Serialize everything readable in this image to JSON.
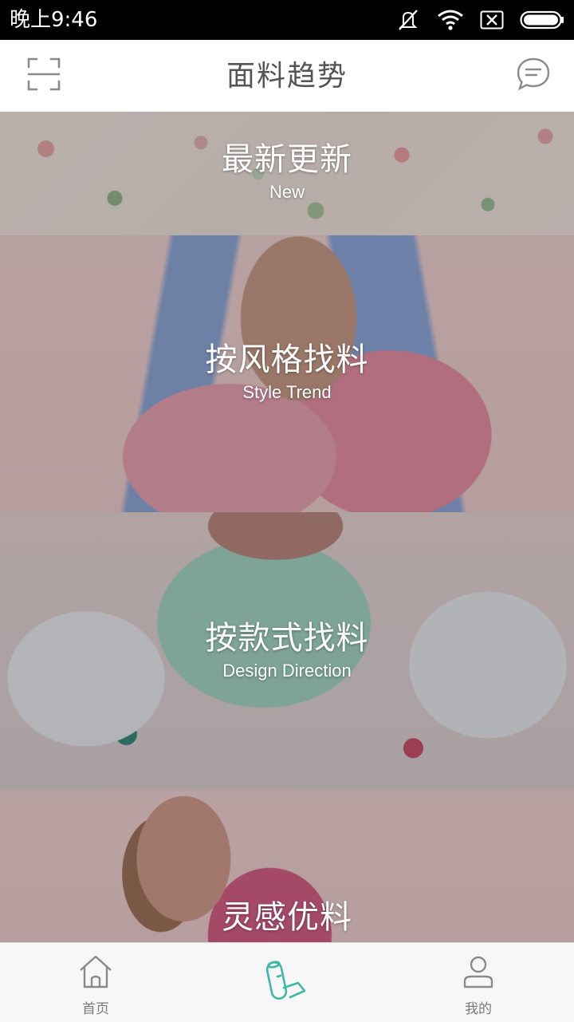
{
  "status_bar": {
    "time": "晚上9:46",
    "icons": [
      "mute-icon",
      "wifi-icon",
      "sim-x-icon",
      "battery-icon"
    ]
  },
  "header": {
    "title": "面料趋势",
    "left_icon": "scan-icon",
    "right_icon": "message-icon"
  },
  "cards": [
    {
      "title_cn": "最新更新",
      "title_en": "New"
    },
    {
      "title_cn": "按风格找料",
      "title_en": "Style Trend"
    },
    {
      "title_cn": "按款式找料",
      "title_en": "Design Direction"
    },
    {
      "title_cn": "灵感优料",
      "title_en": ""
    }
  ],
  "bottom_nav": [
    {
      "label": "首页",
      "icon": "home-icon",
      "active": false
    },
    {
      "label": "",
      "icon": "fabric-roll-icon",
      "active": true
    },
    {
      "label": "我的",
      "icon": "user-icon",
      "active": false
    }
  ],
  "colors": {
    "accent": "#3fb8a8",
    "nav_icon": "#8a8a8a",
    "header_text": "#555555"
  }
}
